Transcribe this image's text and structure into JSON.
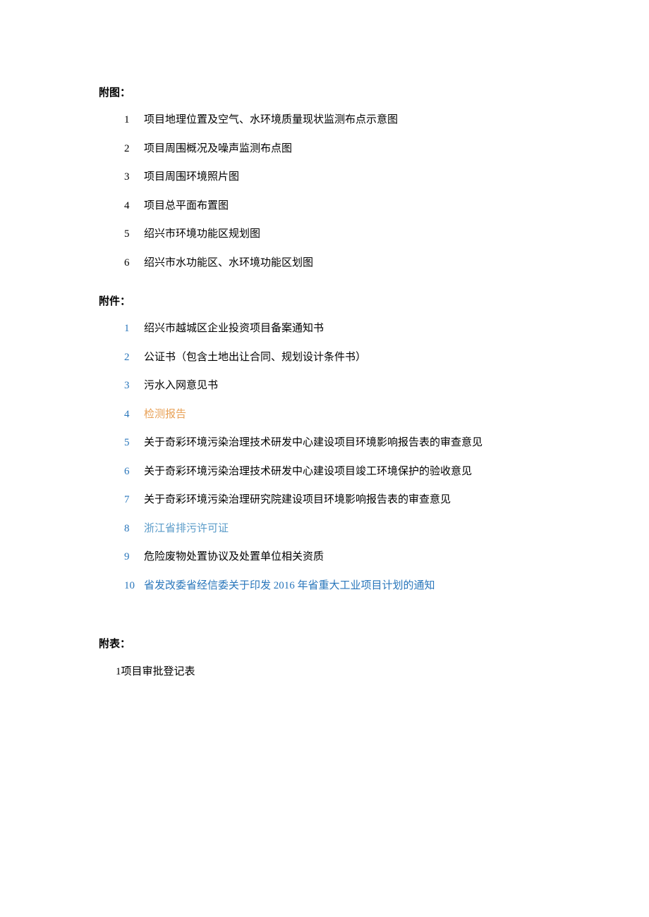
{
  "sections": {
    "futu": {
      "heading": "附图：",
      "items": [
        {
          "num": "1",
          "numClass": "",
          "text": "项目地理位置及空气、水环境质量现状监测布点示意图",
          "textClass": ""
        },
        {
          "num": "2",
          "numClass": "",
          "text": "项目周围概况及噪声监测布点图",
          "textClass": ""
        },
        {
          "num": "3",
          "numClass": "",
          "text": "项目周围环境照片图",
          "textClass": ""
        },
        {
          "num": "4",
          "numClass": "",
          "text": "项目总平面布置图",
          "textClass": ""
        },
        {
          "num": "5",
          "numClass": "",
          "text": "绍兴市环境功能区规划图",
          "textClass": ""
        },
        {
          "num": "6",
          "numClass": "",
          "text": "绍兴市水功能区、水环境功能区划图",
          "textClass": ""
        }
      ]
    },
    "fujian": {
      "heading": "附件：",
      "items": [
        {
          "num": "1",
          "numClass": "color-blue",
          "text": "绍兴市越城区企业投资项目备案通知书",
          "textClass": ""
        },
        {
          "num": "2",
          "numClass": "color-blue",
          "text": "公证书（包含土地出让合同、规划设计条件书）",
          "textClass": ""
        },
        {
          "num": "3",
          "numClass": "color-blue",
          "text": "污水入网意见书",
          "textClass": ""
        },
        {
          "num": "4",
          "numClass": "color-blue",
          "text": "检测报告",
          "textClass": "color-orange"
        },
        {
          "num": "5",
          "numClass": "color-blue",
          "text": "关于奇彩环境污染治理技术研发中心建设项目环境影响报告表的审查意见",
          "textClass": ""
        },
        {
          "num": "6",
          "numClass": "color-blue",
          "text": "关于奇彩环境污染治理技术研发中心建设项目竣工环境保护的验收意见",
          "textClass": ""
        },
        {
          "num": "7",
          "numClass": "color-blue",
          "text": "关于奇彩环境污染治理研究院建设项目环境影响报告表的审查意见",
          "textClass": ""
        },
        {
          "num": "8",
          "numClass": "color-blue",
          "text": "浙江省排污许可证",
          "textClass": "color-lightblue"
        },
        {
          "num": "9",
          "numClass": "color-blue",
          "text": "危险废物处置协议及处置单位相关资质",
          "textClass": ""
        },
        {
          "num": "10",
          "numClass": "color-blue",
          "text": "省发改委省经信委关于印发 2016 年省重大工业项目计划的通知",
          "textClass": "color-blue"
        }
      ]
    },
    "fubiao": {
      "heading": "附表：",
      "items": [
        {
          "num": "1",
          "numClass": "",
          "text": "项目审批登记表",
          "textClass": ""
        }
      ]
    }
  }
}
